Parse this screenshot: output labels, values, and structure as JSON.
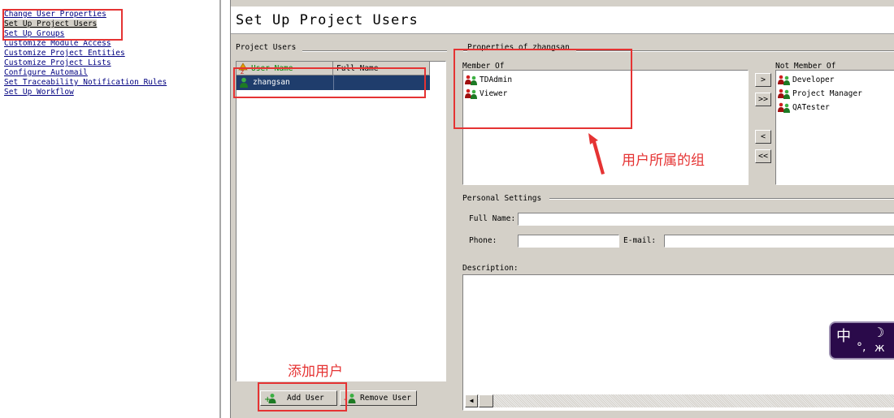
{
  "nav": {
    "links": [
      "Change User Properties",
      "Set Up Project Users",
      "Set Up Groups",
      "Customize Module Access",
      "Customize Project Entities",
      "Customize Project Lists",
      "Configure Automail",
      "Set Traceability Notification Rules",
      "Set Up Workflow"
    ],
    "selected_index": 1
  },
  "page": {
    "title": "Set Up Project Users"
  },
  "users": {
    "section_label": "Project Users",
    "columns": [
      "User Name",
      "Full Name"
    ],
    "rows": [
      {
        "user_name": "zhangsan",
        "full_name": ""
      }
    ],
    "add_label": "Add User",
    "remove_label": "Remove User"
  },
  "properties": {
    "section_label": "Properties of zhangsan",
    "member_of_label": "Member Of",
    "member_of": [
      "TDAdmin",
      "Viewer"
    ],
    "not_member_of_label": "Not Member Of",
    "not_member_of": [
      "Developer",
      "Project Manager",
      "QATester"
    ],
    "buttons": {
      "add_one": ">",
      "add_all": ">>",
      "remove_one": "<",
      "remove_all": "<<"
    }
  },
  "personal": {
    "section_label": "Personal Settings",
    "full_name_label": "Full Name:",
    "full_name_value": "",
    "phone_label": "Phone:",
    "phone_value": "",
    "email_label": "E-mail:",
    "email_value": "",
    "description_label": "Description:",
    "description_value": ""
  },
  "annotations": {
    "groups_note": "用户所属的组",
    "add_user_note": "添加用户"
  },
  "ime": {
    "mode_char": "中",
    "moon_char": "☽",
    "punct": "°,",
    "butterfly": "ж"
  },
  "colors": {
    "accent": "#e53333",
    "selection": "#1f3d6c",
    "panel": "#d4d0c8"
  }
}
